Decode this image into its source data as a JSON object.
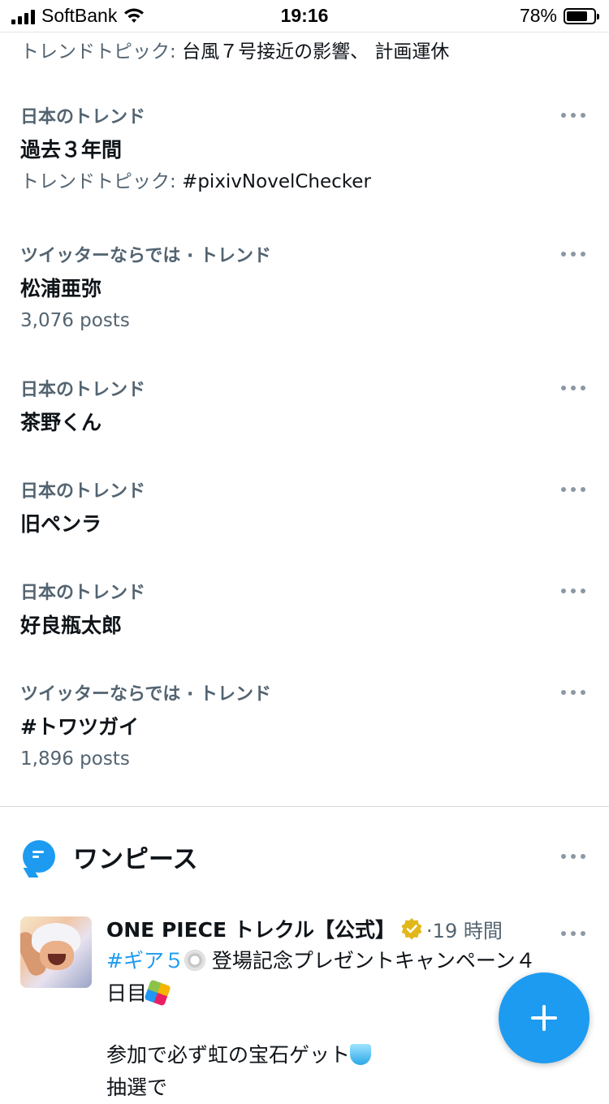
{
  "status_bar": {
    "carrier": "SoftBank",
    "time": "19:16",
    "battery": "78%",
    "battery_level": 0.78
  },
  "top_line": {
    "prefix": "トレンドトピック:",
    "topics": "台風７号接近の影響、 計画運休"
  },
  "trends": [
    {
      "category": "日本のトレンド",
      "name": "過去３年間",
      "sub_prefix": "トレンドトピック:",
      "sub": "#pixivNovelChecker"
    },
    {
      "category": "ツイッターならでは · トレンド",
      "name": "松浦亜弥",
      "sub": "3,076 posts"
    },
    {
      "category": "日本のトレンド",
      "name": "茶野くん"
    },
    {
      "category": "日本のトレンド",
      "name": "旧ペンラ"
    },
    {
      "category": "日本のトレンド",
      "name": "好良瓶太郎"
    },
    {
      "category": "ツイッターならでは · トレンド",
      "name": "#トワツガイ",
      "sub": "1,896 posts"
    }
  ],
  "section": {
    "title": "ワンピース",
    "icon": "topic-bubble-icon",
    "accent": "#1d9bf0"
  },
  "tweet": {
    "author": "ONE PIECE トレクル【公式】",
    "verified_badge": "gold-check-icon",
    "time": "·19 時間",
    "hashtag": "#ギア５",
    "line1_rest": " 登場記念プレゼントキャンペーン４",
    "line2": "日目",
    "line3": "参加で必ず虹の宝石ゲット",
    "line4": "抽選で"
  },
  "fab": {
    "icon": "plus-icon"
  }
}
